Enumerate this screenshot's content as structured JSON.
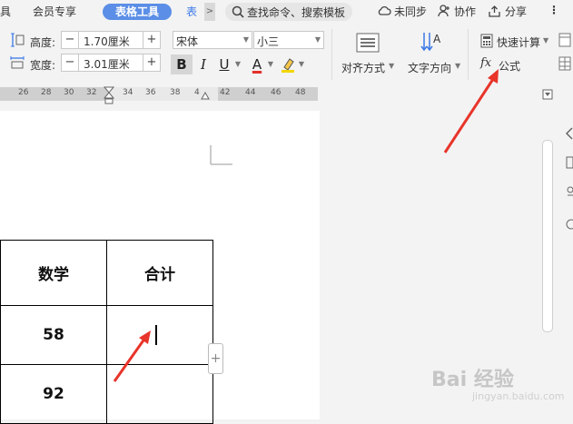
{
  "tabs": {
    "cut_left": "具",
    "member": "会员专享",
    "table_tools": "表格工具",
    "overflow_tab": "表",
    "more": ">"
  },
  "search": {
    "text": "查找命令、搜索模板"
  },
  "topbar": {
    "sync": "未同步",
    "collab": "协作",
    "share": "分享",
    "menu": "⋮"
  },
  "ribbon": {
    "height_label": "高度:",
    "height_value": "1.70厘米",
    "width_label": "宽度:",
    "width_value": "3.01厘米",
    "font_name": "宋体",
    "font_size": "小三",
    "bold": "B",
    "italic": "I",
    "underline": "U",
    "font_color": "A",
    "align": "对齐方式",
    "text_direction": "文字方向",
    "quick_calc": "快速计算",
    "formula": "公式",
    "fx": "fx"
  },
  "ruler": {
    "ticks": [
      "26",
      "28",
      "30",
      "32",
      "34",
      "36",
      "38",
      "4",
      "42",
      "44",
      "46",
      "48"
    ]
  },
  "table": {
    "headers": [
      "数学",
      "合计"
    ],
    "rows": [
      [
        "58",
        ""
      ],
      [
        "92",
        ""
      ]
    ]
  },
  "watermark": {
    "main": "Bai 经验",
    "sub": "jingyan.baidu.com"
  },
  "colors": {
    "accent": "#5b8ee6",
    "arrow": "#e8342a"
  }
}
